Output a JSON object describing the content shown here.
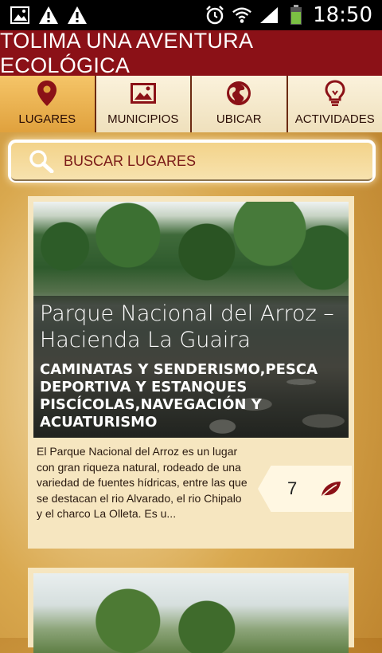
{
  "status_bar": {
    "time": "18:50"
  },
  "header": {
    "title": "TOLIMA UNA AVENTURA ECOLÓGICA"
  },
  "tabs": [
    {
      "label": "LUGARES",
      "icon": "location-pin-icon",
      "active": true
    },
    {
      "label": "MUNICIPIOS",
      "icon": "image-icon",
      "active": false
    },
    {
      "label": "UBICAR",
      "icon": "globe-icon",
      "active": false
    },
    {
      "label": "ACTIVIDADES",
      "icon": "lightbulb-icon",
      "active": false
    }
  ],
  "search": {
    "placeholder": "BUSCAR LUGARES"
  },
  "places": [
    {
      "title": "Parque Nacional del Arroz – Hacienda La Guaira",
      "activities": "CAMINATAS Y SENDERISMO,PESCA DEPORTIVA Y ESTANQUES PISCÍCOLAS,NAVEGACIÓN Y ACUATURISMO",
      "description": "El Parque Nacional del Arroz es un lugar con gran riqueza natural, rodeado de una variedad de fuentes hídricas, entre las que se destacan el rio Alvarado, el rio Chipalo y el charco La Olleta. Es u...",
      "likes": "7"
    }
  ],
  "colors": {
    "header_bg": "#8b1117",
    "accent": "#e0a13d",
    "icon_color": "#8b1117"
  }
}
